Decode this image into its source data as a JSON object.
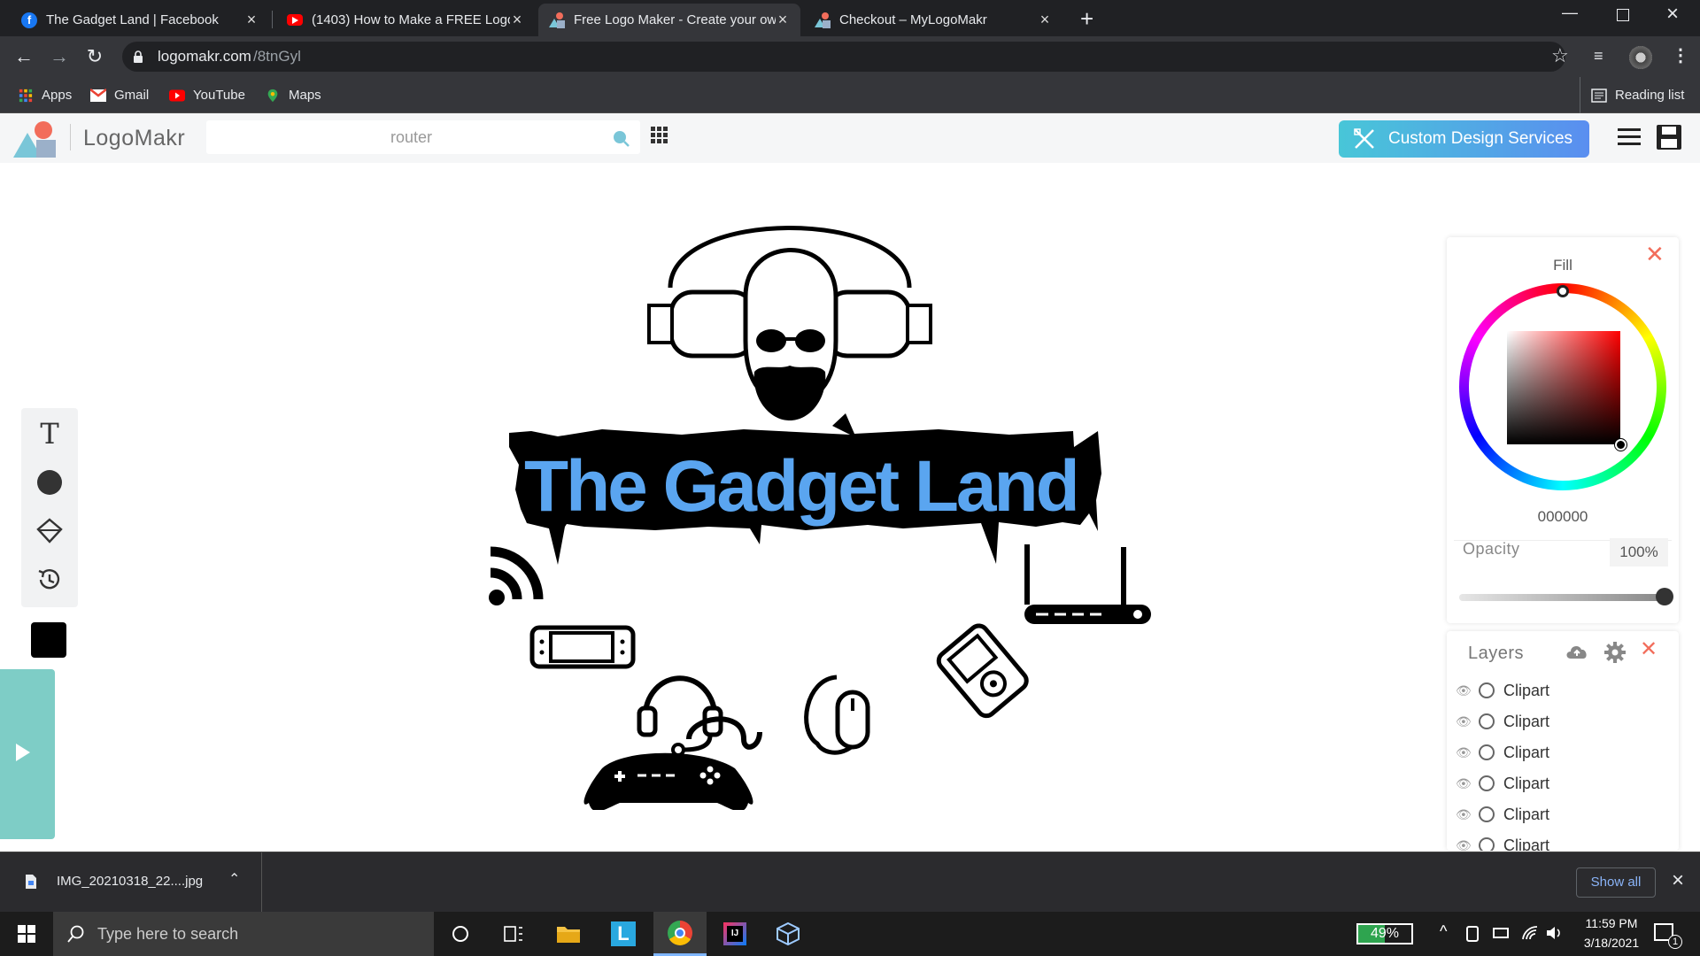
{
  "browser": {
    "tabs": [
      {
        "title": "The Gadget Land | Facebook",
        "icon": "facebook-icon",
        "color": "#1877f2"
      },
      {
        "title": "(1403) How to Make a FREE Logo",
        "icon": "youtube-icon",
        "color": "#ff0000"
      },
      {
        "title": "Free Logo Maker - Create your own",
        "icon": "logomakr-icon",
        "color": "#7ac6d8",
        "active": true
      },
      {
        "title": "Checkout – MyLogoMakr",
        "icon": "logomakr-icon",
        "color": "#7ac6d8"
      }
    ],
    "url_host": "logomakr.com",
    "url_path": "/8tnGyl",
    "bookmarks": [
      {
        "label": "Apps",
        "icon": "apps-grid-icon"
      },
      {
        "label": "Gmail",
        "icon": "gmail-icon"
      },
      {
        "label": "YouTube",
        "icon": "youtube-icon"
      },
      {
        "label": "Maps",
        "icon": "maps-icon"
      }
    ],
    "reading_list": "Reading list"
  },
  "app": {
    "logo_text": "LogoMakr",
    "search_value": "router",
    "custom_design_label": "Custom Design Services",
    "canvas_title": "The Gadget Land"
  },
  "color_panel": {
    "fill_label": "Fill",
    "hex_value": "000000",
    "opacity_label": "Opacity",
    "opacity_value": "100%",
    "opacity_level": 1.0
  },
  "layers_panel": {
    "title": "Layers",
    "items": [
      "Clipart",
      "Clipart",
      "Clipart",
      "Clipart",
      "Clipart",
      "Clipart"
    ]
  },
  "downloads": {
    "filename": "IMG_20210318_22....jpg",
    "show_all": "Show all"
  },
  "taskbar": {
    "search_placeholder": "Type here to search",
    "battery": "49%",
    "time": "11:59 PM",
    "date": "3/18/2021",
    "notification_count": "1"
  },
  "colors": {
    "accent": "#7ac6d8",
    "brand_blue": "#5aa5f0"
  }
}
